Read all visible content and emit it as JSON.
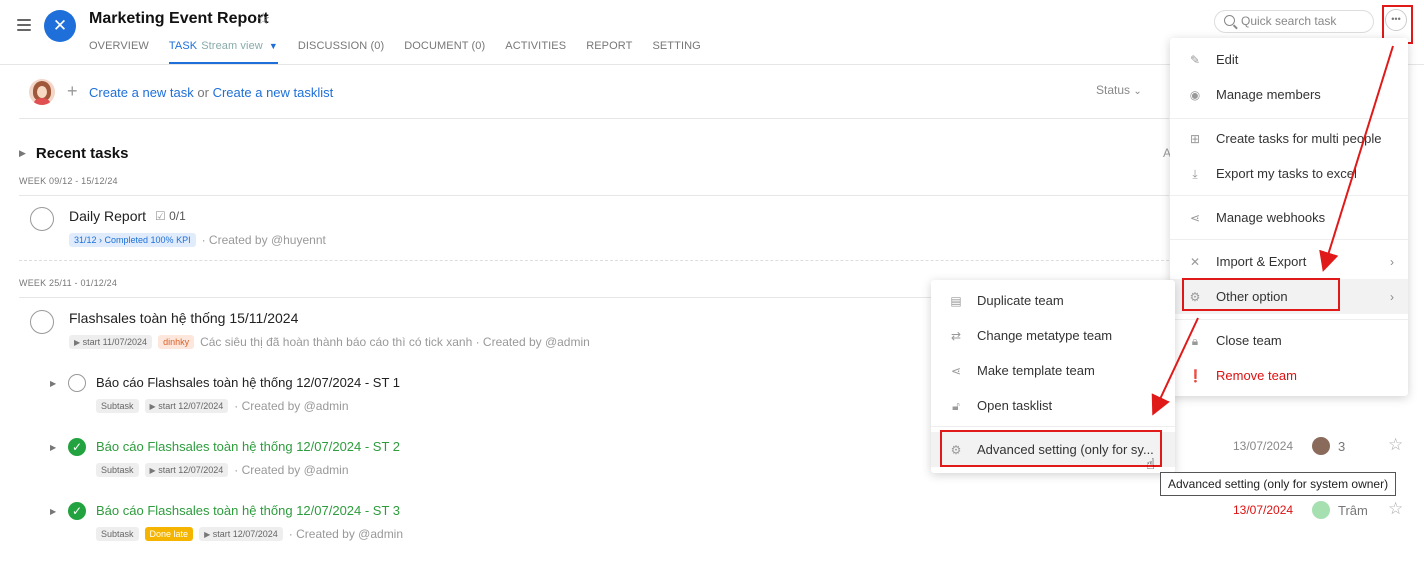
{
  "header": {
    "title": "Marketing Event Report",
    "tabs": [
      {
        "label": "OVERVIEW"
      },
      {
        "label": "TASK",
        "sub": "Stream view"
      },
      {
        "label": "DISCUSSION (0)"
      },
      {
        "label": "DOCUMENT (0)"
      },
      {
        "label": "ACTIVITIES"
      },
      {
        "label": "REPORT"
      },
      {
        "label": "SETTING"
      }
    ],
    "search_placeholder": "Quick search task",
    "more": "•••"
  },
  "create": {
    "new_task": "Create a new task",
    "or": "or",
    "new_tasklist": "Create a new tasklist",
    "status": "Status"
  },
  "section": {
    "title": "Recent tasks"
  },
  "weeks": [
    {
      "label": "WEEK 09/12 - 15/12/24",
      "tasks": [
        {
          "name": "Daily Report",
          "checklist": "0/1",
          "badge": "31/12 › Completed 100% KPI",
          "created": "· Created by @huyennt"
        }
      ]
    },
    {
      "label": "WEEK 25/11 - 01/12/24",
      "tasks": [
        {
          "name": "Flashsales toàn hệ thống 15/11/2024",
          "start": "start 11/07/2024",
          "tag": "dinhky",
          "note": "Các siêu thị đã hoàn thành báo cáo thì có tick xanh · Created by @admin"
        }
      ]
    }
  ],
  "subtasks": [
    {
      "name": "Báo cáo Flashsales toàn hệ thống 12/07/2024 - ST 1",
      "type": "Subtask",
      "start": "start 12/07/2024",
      "created": "· Created by @admin"
    },
    {
      "name": "Báo cáo Flashsales toàn hệ thống 12/07/2024 - ST 2",
      "type": "Subtask",
      "start": "start 12/07/2024",
      "created": "· Created by @admin",
      "date": "13/07/2024",
      "count": "3"
    },
    {
      "name": "Báo cáo Flashsales toàn hệ thống 12/07/2024 - ST 3",
      "type": "Subtask",
      "late": "Done late",
      "start": "start 12/07/2024",
      "created": "· Created by @admin",
      "date": "13/07/2024",
      "assignee": "Trâm"
    }
  ],
  "main_menu": {
    "items": [
      {
        "label": "Edit",
        "icon": "pencil-icon"
      },
      {
        "label": "Manage members",
        "icon": "user-circle-icon"
      },
      {
        "label": "Create tasks for multi people",
        "icon": "plus-square-icon"
      },
      {
        "label": "Export my tasks to excel",
        "icon": "download-icon"
      },
      {
        "label": "Manage webhooks",
        "icon": "share-icon"
      },
      {
        "label": "Import & Export",
        "icon": "x-icon"
      },
      {
        "label": "Other option",
        "icon": "gear-icon"
      },
      {
        "label": "Close team",
        "icon": "lock-icon"
      },
      {
        "label": "Remove team",
        "icon": "alert-icon"
      }
    ]
  },
  "sub_menu": {
    "items": [
      {
        "label": "Duplicate team",
        "icon": "clipboard-icon"
      },
      {
        "label": "Change metatype team",
        "icon": "swap-icon"
      },
      {
        "label": "Make template team",
        "icon": "share-icon"
      },
      {
        "label": "Open tasklist",
        "icon": "lock-icon"
      },
      {
        "label": "Advanced setting (only for sy...",
        "icon": "gear-icon"
      }
    ]
  },
  "tooltip": "Advanced setting (only for system owner)",
  "colors": {
    "accent": "#1e6fd9",
    "highlight": "#e01919",
    "done": "#23a340"
  }
}
